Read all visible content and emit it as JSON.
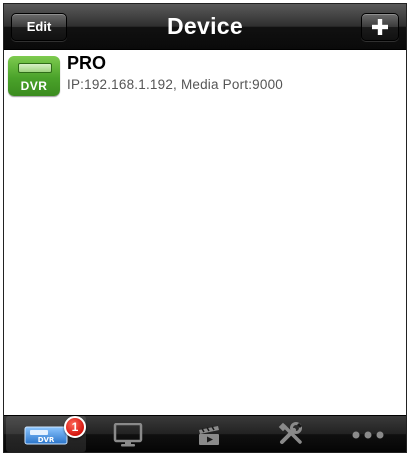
{
  "navbar": {
    "title": "Device",
    "edit_label": "Edit",
    "add_icon": "plus-icon"
  },
  "devices": [
    {
      "icon": "dvr-icon",
      "icon_label": "DVR",
      "name": "PRO",
      "info": "IP:192.168.1.192, Media Port:9000"
    }
  ],
  "tabbar": {
    "tabs": [
      {
        "icon": "dvr-device-icon",
        "label": "DVR",
        "selected": true,
        "badge": "1"
      },
      {
        "icon": "monitor-icon",
        "selected": false
      },
      {
        "icon": "video-playback-icon",
        "selected": false
      },
      {
        "icon": "tools-icon",
        "selected": false
      },
      {
        "icon": "more-dots-icon",
        "selected": false
      }
    ]
  },
  "colors": {
    "accent_green": "#4aa22a",
    "badge_red": "#d4150e",
    "active_tab_blue": "#3d8fe0"
  }
}
